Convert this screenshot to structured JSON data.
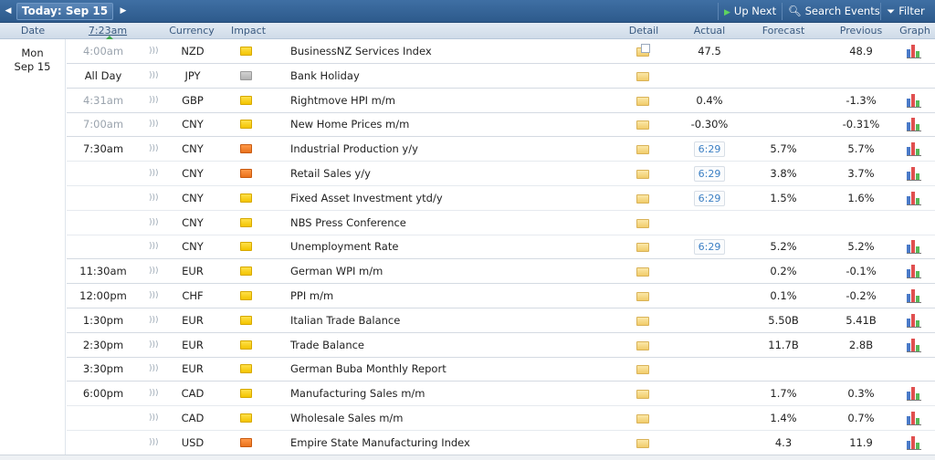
{
  "toolbar": {
    "prev_label": "◀",
    "today_label": "Today: Sep 15",
    "next_label": "▶",
    "up_next_label": "Up Next",
    "search_label": "Search Events",
    "filter_label": "Filter"
  },
  "header": {
    "date": "Date",
    "time": "7:23am",
    "currency": "Currency",
    "impact": "Impact",
    "detail": "Detail",
    "actual": "Actual",
    "forecast": "Forecast",
    "previous": "Previous",
    "graph": "Graph"
  },
  "day": {
    "weekday": "Mon",
    "date": "Sep 15"
  },
  "colors": {
    "impact_yellow": "#f3c400",
    "impact_orange": "#e9721b",
    "impact_gray": "#b2b2b2"
  },
  "rows": [
    {
      "time": "4:00am",
      "time_gray": true,
      "currency": "NZD",
      "impact": "yellow",
      "event": "BusinessNZ Services Index",
      "detail_icon": "folder-doc-icon",
      "actual": "47.5",
      "countdown": "",
      "forecast": "",
      "previous": "48.9",
      "graph": true
    },
    {
      "time": "All Day",
      "time_gray": false,
      "currency": "JPY",
      "impact": "gray",
      "event": "Bank Holiday",
      "detail_icon": "folder-icon",
      "actual": "",
      "countdown": "",
      "forecast": "",
      "previous": "",
      "graph": false
    },
    {
      "time": "4:31am",
      "time_gray": true,
      "currency": "GBP",
      "impact": "yellow",
      "event": "Rightmove HPI m/m",
      "detail_icon": "folder-icon",
      "actual": "0.4%",
      "countdown": "",
      "forecast": "",
      "previous": "-1.3%",
      "graph": true
    },
    {
      "time": "7:00am",
      "time_gray": true,
      "currency": "CNY",
      "impact": "yellow",
      "event": "New Home Prices m/m",
      "detail_icon": "folder-icon",
      "actual": "-0.30%",
      "countdown": "",
      "forecast": "",
      "previous": "-0.31%",
      "graph": true
    },
    {
      "time": "7:30am",
      "time_gray": false,
      "currency": "CNY",
      "impact": "orange",
      "event": "Industrial Production y/y",
      "detail_icon": "folder-icon",
      "actual": "",
      "countdown": "6:29",
      "forecast": "5.7%",
      "previous": "5.7%",
      "graph": true
    },
    {
      "time": "",
      "time_gray": false,
      "currency": "CNY",
      "impact": "orange",
      "event": "Retail Sales y/y",
      "detail_icon": "folder-icon",
      "actual": "",
      "countdown": "6:29",
      "forecast": "3.8%",
      "previous": "3.7%",
      "graph": true
    },
    {
      "time": "",
      "time_gray": false,
      "currency": "CNY",
      "impact": "yellow",
      "event": "Fixed Asset Investment ytd/y",
      "detail_icon": "folder-icon",
      "actual": "",
      "countdown": "6:29",
      "forecast": "1.5%",
      "previous": "1.6%",
      "graph": true
    },
    {
      "time": "",
      "time_gray": false,
      "currency": "CNY",
      "impact": "yellow",
      "event": "NBS Press Conference",
      "detail_icon": "folder-icon",
      "actual": "",
      "countdown": "",
      "forecast": "",
      "previous": "",
      "graph": false
    },
    {
      "time": "",
      "time_gray": false,
      "currency": "CNY",
      "impact": "yellow",
      "event": "Unemployment Rate",
      "detail_icon": "folder-icon",
      "actual": "",
      "countdown": "6:29",
      "forecast": "5.2%",
      "previous": "5.2%",
      "graph": true
    },
    {
      "time": "11:30am",
      "time_gray": false,
      "currency": "EUR",
      "impact": "yellow",
      "event": "German WPI m/m",
      "detail_icon": "folder-icon",
      "actual": "",
      "countdown": "",
      "forecast": "0.2%",
      "previous": "-0.1%",
      "graph": true
    },
    {
      "time": "12:00pm",
      "time_gray": false,
      "currency": "CHF",
      "impact": "yellow",
      "event": "PPI m/m",
      "detail_icon": "folder-icon",
      "actual": "",
      "countdown": "",
      "forecast": "0.1%",
      "previous": "-0.2%",
      "graph": true
    },
    {
      "time": "1:30pm",
      "time_gray": false,
      "currency": "EUR",
      "impact": "yellow",
      "event": "Italian Trade Balance",
      "detail_icon": "folder-icon",
      "actual": "",
      "countdown": "",
      "forecast": "5.50B",
      "previous": "5.41B",
      "graph": true
    },
    {
      "time": "2:30pm",
      "time_gray": false,
      "currency": "EUR",
      "impact": "yellow",
      "event": "Trade Balance",
      "detail_icon": "folder-icon",
      "actual": "",
      "countdown": "",
      "forecast": "11.7B",
      "previous": "2.8B",
      "graph": true
    },
    {
      "time": "3:30pm",
      "time_gray": false,
      "currency": "EUR",
      "impact": "yellow",
      "event": "German Buba Monthly Report",
      "detail_icon": "folder-icon",
      "actual": "",
      "countdown": "",
      "forecast": "",
      "previous": "",
      "graph": false
    },
    {
      "time": "6:00pm",
      "time_gray": false,
      "currency": "CAD",
      "impact": "yellow",
      "event": "Manufacturing Sales m/m",
      "detail_icon": "folder-icon",
      "actual": "",
      "countdown": "",
      "forecast": "1.7%",
      "previous": "0.3%",
      "graph": true
    },
    {
      "time": "",
      "time_gray": false,
      "currency": "CAD",
      "impact": "yellow",
      "event": "Wholesale Sales m/m",
      "detail_icon": "folder-icon",
      "actual": "",
      "countdown": "",
      "forecast": "1.4%",
      "previous": "0.7%",
      "graph": true
    },
    {
      "time": "",
      "time_gray": false,
      "currency": "USD",
      "impact": "orange",
      "event": "Empire State Manufacturing Index",
      "detail_icon": "folder-icon",
      "actual": "",
      "countdown": "",
      "forecast": "4.3",
      "previous": "11.9",
      "graph": true
    }
  ]
}
